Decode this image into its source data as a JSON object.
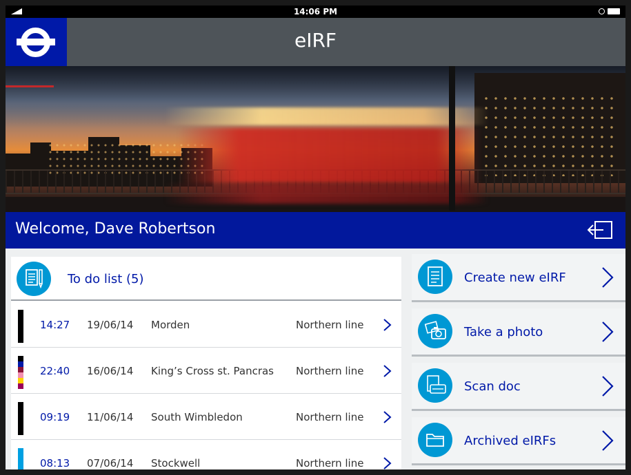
{
  "status_bar": {
    "time": "14:06 PM"
  },
  "app": {
    "title": "eIRF"
  },
  "welcome": {
    "text": "Welcome, Dave Robertson"
  },
  "todo": {
    "title": "To do list (5)",
    "items": [
      {
        "time": "14:27",
        "date": "19/06/14",
        "station": "Morden",
        "line": "Northern line",
        "strip": [
          "#000000"
        ]
      },
      {
        "time": "22:40",
        "date": "16/06/14",
        "station": "King’s Cross st. Pancras",
        "line": "Northern line",
        "strip": [
          "#000000",
          "#0019a8",
          "#8b1538",
          "#f48fb1",
          "#ffd300",
          "#9b0058"
        ]
      },
      {
        "time": "09:19",
        "date": "11/06/14",
        "station": "South Wimbledon",
        "line": "Northern line",
        "strip": [
          "#000000"
        ]
      },
      {
        "time": "08:13",
        "date": "07/06/14",
        "station": "Stockwell",
        "line": "Northern line",
        "strip": [
          "#00a0e2"
        ]
      }
    ]
  },
  "actions": [
    {
      "label": "Create new eIRF",
      "icon": "document-icon"
    },
    {
      "label": "Take a photo",
      "icon": "camera-icon"
    },
    {
      "label": "Scan doc",
      "icon": "scan-doc-icon"
    },
    {
      "label": "Archived eIRFs",
      "icon": "folder-icon"
    }
  ],
  "colors": {
    "brand_blue": "#0019a8",
    "accent_cyan": "#0098d4",
    "app_bar": "#4e5459"
  }
}
